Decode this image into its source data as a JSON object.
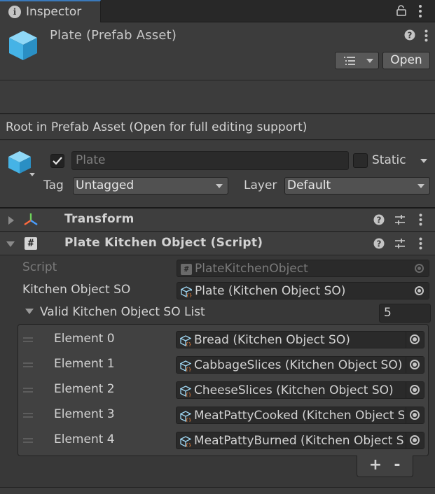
{
  "tab": {
    "title": "Inspector"
  },
  "prefab_header": {
    "title": "Plate (Prefab Asset)",
    "open_button": "Open"
  },
  "notice": "Root in Prefab Asset (Open for full editing support)",
  "gameobject": {
    "active": true,
    "name_placeholder": "Plate",
    "static_label": "Static",
    "static_checked": false,
    "tag_label": "Tag",
    "tag_value": "Untagged",
    "layer_label": "Layer",
    "layer_value": "Default"
  },
  "components": {
    "transform": {
      "title": "Transform",
      "expanded": false
    },
    "script": {
      "title": "Plate Kitchen Object (Script)",
      "expanded": true,
      "script_label": "Script",
      "script_value": "PlateKitchenObject",
      "kos_label": "Kitchen Object SO",
      "kos_value": "Plate (Kitchen Object SO)",
      "list_label": "Valid Kitchen Object SO List",
      "list_size": "5",
      "elements": [
        {
          "label": "Element 0",
          "value": "Bread (Kitchen Object SO)"
        },
        {
          "label": "Element 1",
          "value": "CabbageSlices (Kitchen Object SO)"
        },
        {
          "label": "Element 2",
          "value": "CheeseSlices (Kitchen Object SO)"
        },
        {
          "label": "Element 3",
          "value": "MeatPattyCooked (Kitchen Object SO)"
        },
        {
          "label": "Element 4",
          "value": "MeatPattyBurned (Kitchen Object SO)"
        }
      ],
      "add_label": "+",
      "remove_label": "-"
    }
  },
  "colors": {
    "accent_tab": "#3a79bb",
    "cube_light": "#5fc4f0",
    "panel_bg": "#383838",
    "header_bg": "#3c3c3c"
  }
}
